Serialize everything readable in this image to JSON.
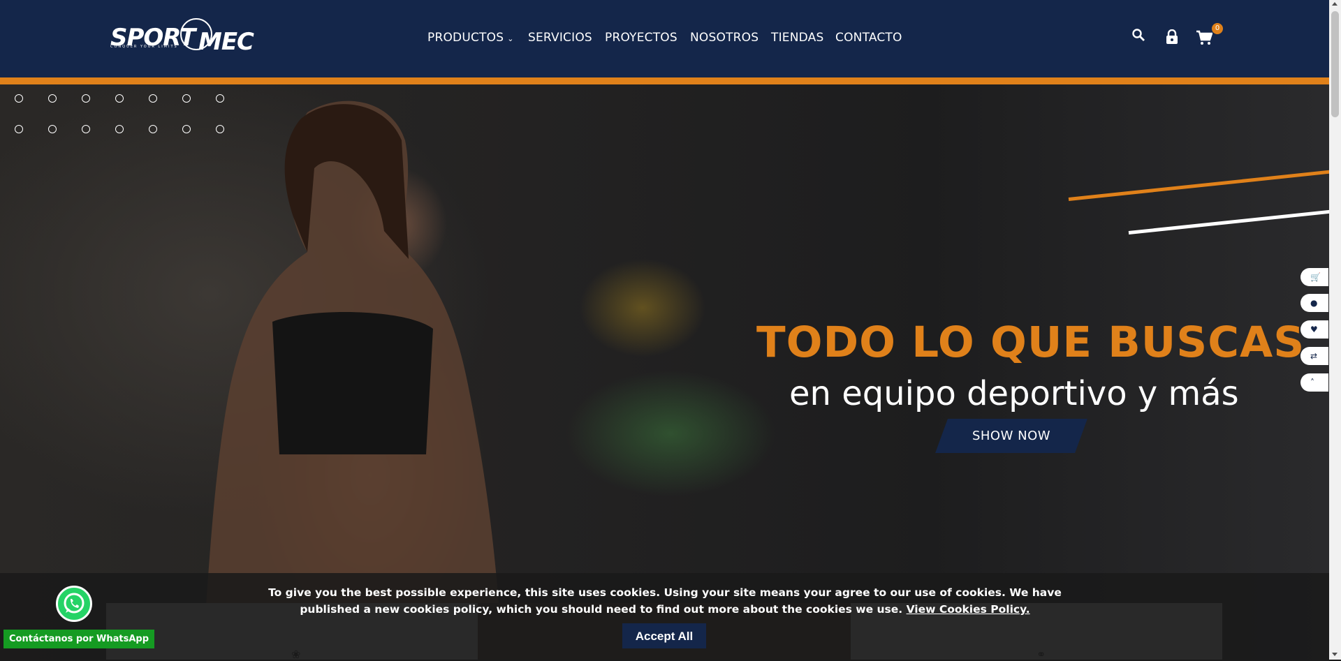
{
  "header": {
    "logo": {
      "word1": "SPORT",
      "word2": "MEC",
      "tagline": "CONQUER YOUR LIMITS"
    },
    "nav": [
      {
        "label": "PRODUCTOS",
        "has_dropdown": true
      },
      {
        "label": "SERVICIOS"
      },
      {
        "label": "PROYECTOS"
      },
      {
        "label": "NOSOTROS"
      },
      {
        "label": "TIENDAS"
      },
      {
        "label": "CONTACTO"
      }
    ],
    "icons": [
      "search-icon",
      "lock-icon",
      "cart-icon"
    ],
    "cart_count": "0"
  },
  "hero": {
    "headline": "TODO LO QUE BUSCAS",
    "subline": "en equipo deportivo y más",
    "cta": "SHOW NOW"
  },
  "side_tools": [
    "cart-icon",
    "user-icon",
    "heart-icon",
    "compare-icon",
    "chevron-up-icon"
  ],
  "cookie": {
    "text": "To give you the best possible experience, this site uses cookies. Using your site means your agree to our use of cookies. We have published a new cookies policy, which you should need to find out more about the cookies we use.",
    "link": "View Cookies Policy.",
    "accept": "Accept All"
  },
  "whatsapp": {
    "label": "Contáctanos por WhatsApp"
  },
  "colors": {
    "navy": "#14264a",
    "orange": "#e0811a",
    "whatsapp": "#25d366"
  }
}
